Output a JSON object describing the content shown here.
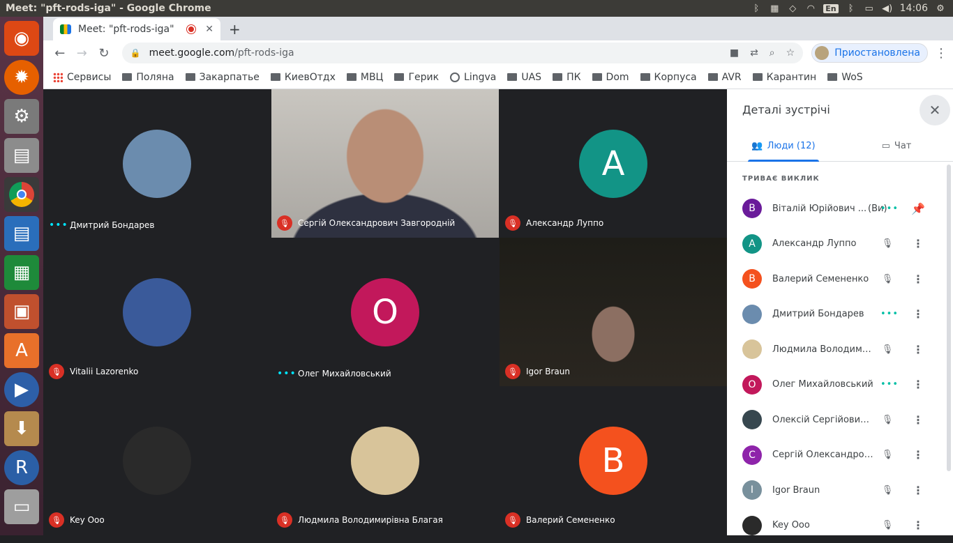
{
  "os_bar": {
    "window_title": "Meet: \"pft-rods-iga\" - Google Chrome",
    "keyboard_layout": "En",
    "clock": "14:06"
  },
  "launcher": {
    "apps": [
      "ubuntu-dash",
      "firefox",
      "system-settings",
      "files",
      "chrome",
      "writer",
      "calc",
      "impress",
      "software-center",
      "media-player",
      "archive-manager",
      "r-language",
      "scanner"
    ]
  },
  "browser": {
    "tab_title": "Meet: \"pft-rods-iga\"",
    "new_tab": "+",
    "url_host": "meet.google.com",
    "url_path": "/pft-rods-iga",
    "profile_label": "Приостановлена",
    "bookmarks": [
      {
        "label": "Сервисы",
        "icon": "apps-grid-icon"
      },
      {
        "label": "Поляна",
        "icon": "folder-icon"
      },
      {
        "label": "Закарпатье",
        "icon": "folder-icon"
      },
      {
        "label": "КиевОтдх",
        "icon": "folder-icon"
      },
      {
        "label": "МВЦ",
        "icon": "folder-icon"
      },
      {
        "label": "Герик",
        "icon": "folder-icon"
      },
      {
        "label": "Lingva",
        "icon": "globe-icon"
      },
      {
        "label": "UAS",
        "icon": "folder-icon"
      },
      {
        "label": "ПК",
        "icon": "folder-icon"
      },
      {
        "label": "Dom",
        "icon": "folder-icon"
      },
      {
        "label": "Корпуса",
        "icon": "folder-icon"
      },
      {
        "label": "AVR",
        "icon": "folder-icon"
      },
      {
        "label": "Карантин",
        "icon": "folder-icon"
      },
      {
        "label": "WoS",
        "icon": "folder-icon"
      }
    ]
  },
  "meeting_grid": [
    {
      "name": "Дмитрий Бондарев",
      "status": "talking",
      "kind": "photo",
      "avatar_color": "#6b8cae"
    },
    {
      "name": "Сергій Олександрович Завгородній",
      "status": "muted",
      "kind": "video"
    },
    {
      "name": "Александр Луппо",
      "status": "muted",
      "kind": "letter",
      "letter": "A",
      "avatar_color": "#129486"
    },
    {
      "name": "Vitalii Lazorenko",
      "status": "muted",
      "kind": "photo",
      "avatar_color": "#3a5a9a"
    },
    {
      "name": "Олег Михайловський",
      "status": "talking",
      "kind": "letter",
      "letter": "O",
      "avatar_color": "#c2185b"
    },
    {
      "name": "Igor Braun",
      "status": "muted",
      "kind": "video"
    },
    {
      "name": "Key Ooo",
      "status": "muted",
      "kind": "photo",
      "avatar_color": "#2a2a2a"
    },
    {
      "name": "Людмила Володимирівна Благая",
      "status": "muted",
      "kind": "photo",
      "avatar_color": "#d8c49a"
    },
    {
      "name": "Валерий Семененко",
      "status": "muted",
      "kind": "letter",
      "letter": "B",
      "avatar_color": "#f4511e"
    }
  ],
  "panel": {
    "title": "Деталі зустрічі",
    "people_tab": "Люди (12)",
    "chat_tab": "Чат",
    "section_label": "ТРИВАЄ ВИКЛИК",
    "people": [
      {
        "name": "Віталій Юрійович ...",
        "you": "(Ви)",
        "letter": "В",
        "color": "#6a1b9a",
        "status": "talking",
        "action": "pin"
      },
      {
        "name": "Александр Луппо",
        "letter": "A",
        "color": "#129486",
        "status": "muted",
        "action": "more"
      },
      {
        "name": "Валерий Семененко",
        "letter": "В",
        "color": "#f4511e",
        "status": "muted",
        "action": "more"
      },
      {
        "name": "Дмитрий Бондарев",
        "letter": "",
        "color": "#6b8cae",
        "status": "talking",
        "action": "more"
      },
      {
        "name": "Людмила Володимирі...",
        "letter": "",
        "color": "#d8c49a",
        "status": "muted",
        "action": "more"
      },
      {
        "name": "Олег Михайловський",
        "letter": "O",
        "color": "#c2185b",
        "status": "talking",
        "action": "more"
      },
      {
        "name": "Олексій Сергійович П...",
        "letter": "",
        "color": "#37474f",
        "status": "muted",
        "action": "more"
      },
      {
        "name": "Сергій Олександрови...",
        "letter": "C",
        "color": "#8e24aa",
        "status": "muted",
        "action": "more"
      },
      {
        "name": "Igor Braun",
        "letter": "I",
        "color": "#78909c",
        "status": "muted",
        "action": "more"
      },
      {
        "name": "Key Ooo",
        "letter": "",
        "color": "#2a2a2a",
        "status": "muted",
        "action": "more"
      }
    ]
  }
}
